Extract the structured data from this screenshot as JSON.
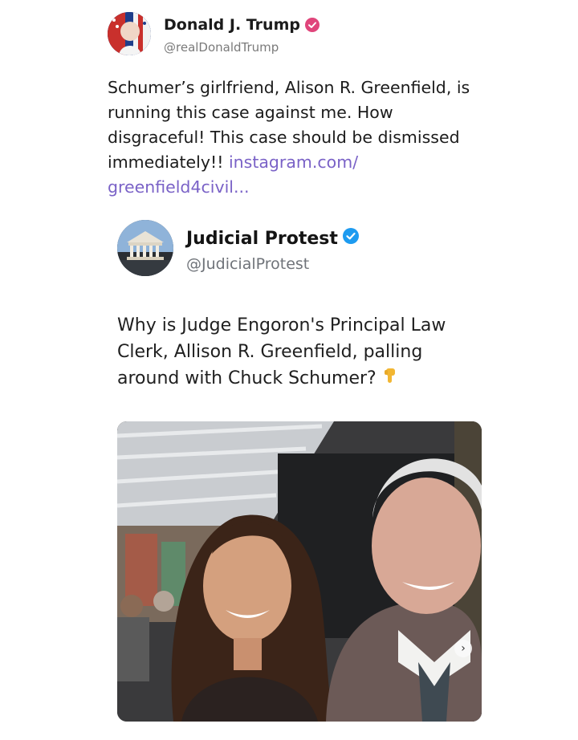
{
  "main_post": {
    "author_name": "Donald J. Trump",
    "author_handle": "@realDonaldTrump",
    "text_lines": [
      "Schumer’s girlfriend, Alison R. Greenfield, is",
      "running this case against me. How",
      "disgraceful! This case should be dismissed",
      "immediately!! "
    ],
    "link_part1": "instagram.com/",
    "link_part2": "greenfield4civil...",
    "badge_color": "#e0457b",
    "link_color": "#7a62c7"
  },
  "quoted_post": {
    "author_name": "Judicial Protest",
    "author_handle": "@JudicialProtest",
    "text_lines": [
      "Why is Judge Engoron's Principal Law",
      "Clerk, Allison R. Greenfield, palling",
      "around with Chuck Schumer?"
    ],
    "emoji_icon": "backhand-index-pointing-down",
    "badge_color": "#1d9bf0"
  },
  "photo": {
    "next_icon": "chevron-right"
  }
}
